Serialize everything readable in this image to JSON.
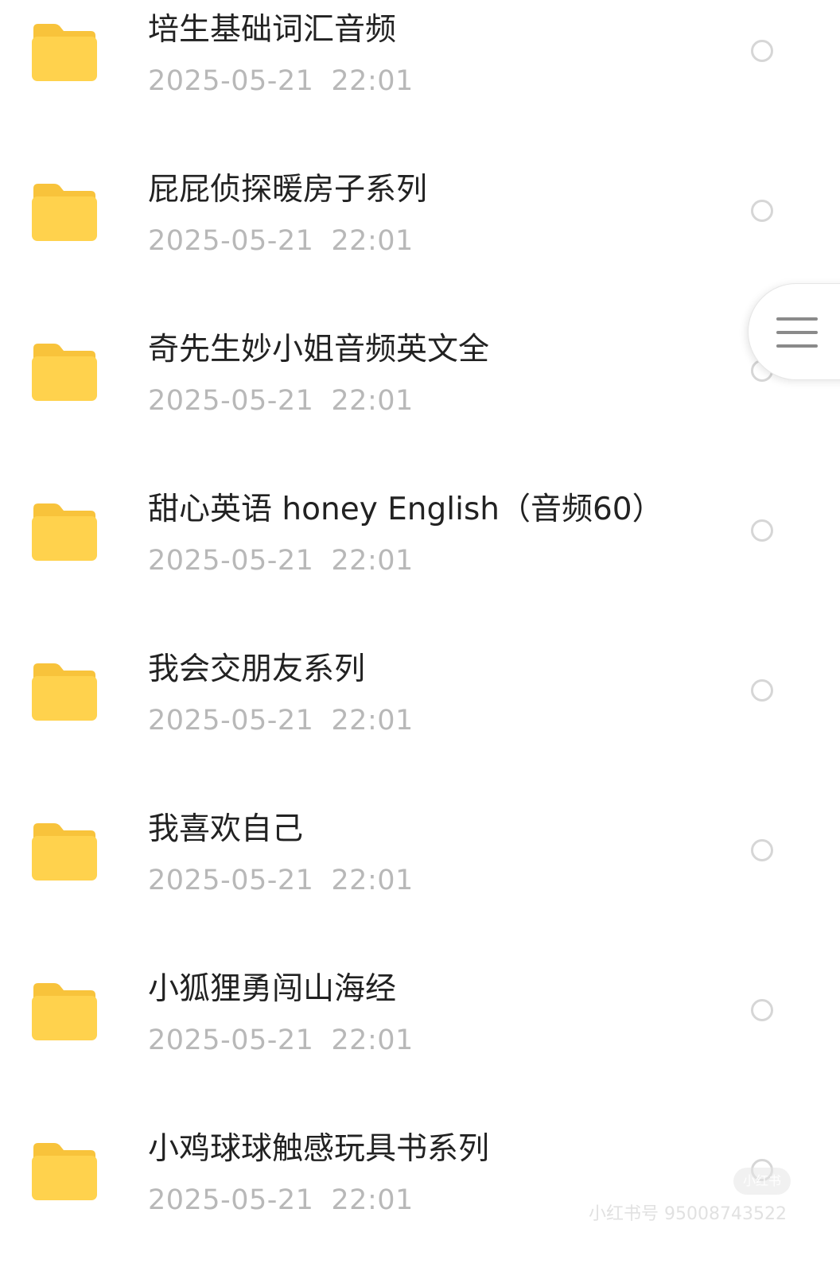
{
  "folder_color": "#FFD24D",
  "folder_tab_color": "#F8C33B",
  "items": [
    {
      "name": "培生基础词汇音频",
      "date": "2025-05-21",
      "time": "22:01"
    },
    {
      "name": "屁屁侦探暖房子系列",
      "date": "2025-05-21",
      "time": "22:01"
    },
    {
      "name": "奇先生妙小姐音频英文全",
      "date": "2025-05-21",
      "time": "22:01"
    },
    {
      "name": "甜心英语 honey English（音频60）",
      "date": "2025-05-21",
      "time": "22:01"
    },
    {
      "name": "我会交朋友系列",
      "date": "2025-05-21",
      "time": "22:01"
    },
    {
      "name": "我喜欢自己",
      "date": "2025-05-21",
      "time": "22:01"
    },
    {
      "name": "小狐狸勇闯山海经",
      "date": "2025-05-21",
      "time": "22:01"
    },
    {
      "name": "小鸡球球触感玩具书系列",
      "date": "2025-05-21",
      "time": "22:01"
    }
  ],
  "floating_menu": {
    "icon": "menu-icon"
  },
  "watermark": {
    "badge": "小红书",
    "text": "小红书号 95008743522"
  }
}
